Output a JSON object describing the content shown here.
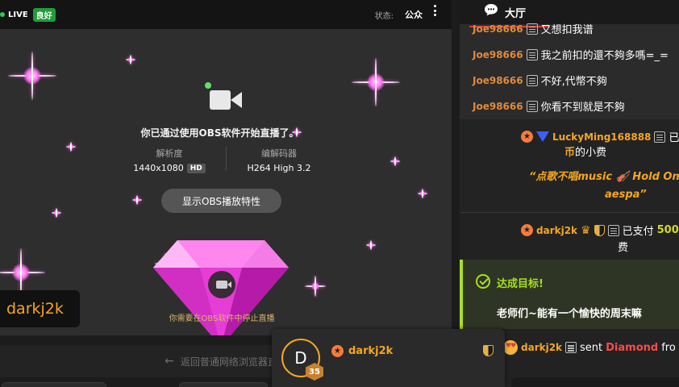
{
  "topbar": {
    "live_label": "LIVE",
    "quality_badge": "良好",
    "status_label": "状态:",
    "status_value": "公众"
  },
  "stream": {
    "obs_message": "你已通过使用OBS软件开始直播了。",
    "resolution_label": "解析度",
    "resolution_value": "1440x1080",
    "resolution_badge": "HD",
    "codec_label": "编解码器",
    "codec_value": "H264 High 3.2",
    "obs_button": "显示OBS播放特性",
    "stop_message": "你需要在OBS软件中停止直播",
    "streamer_name": "darkj2k",
    "back_link": "返回普通网络浏览器直播"
  },
  "chat": {
    "title": "大厅",
    "lines": [
      {
        "user": "Joe98666",
        "text": "又想扣我谱"
      },
      {
        "user": "Joe98666",
        "text": "我之前扣的還不夠多嗎=_="
      },
      {
        "user": "Joe98666",
        "text": "不好,代幣不夠"
      },
      {
        "user": "Joe98666",
        "text": "你看不到就是不夠"
      }
    ],
    "tip1": {
      "user": "LuckyMing168888",
      "text_pre": "已",
      "coin_word": "币",
      "text_post": "的小费",
      "song_line": "“点歌不唱music 🎻 Hold On",
      "song_artist": "aespa”"
    },
    "tip2": {
      "user": "darkj2k",
      "text_pre": "已支付",
      "amount": "500",
      "text_post": "费"
    },
    "goal": {
      "title": "达成目标!",
      "text": "老师们~能有一个愉快的周末嘛"
    },
    "gift": {
      "user": "darkj2k",
      "verb": "sent",
      "item": "Diamond",
      "tail": "fro"
    }
  },
  "viewer_card": {
    "avatar_letter": "D",
    "level": "35",
    "name": "darkj2k"
  },
  "colors": {
    "accent_orange": "#f5a623",
    "goal_green": "#a6e022",
    "live_green": "#1f9d3a",
    "diamond_red": "#ff4a4a"
  }
}
